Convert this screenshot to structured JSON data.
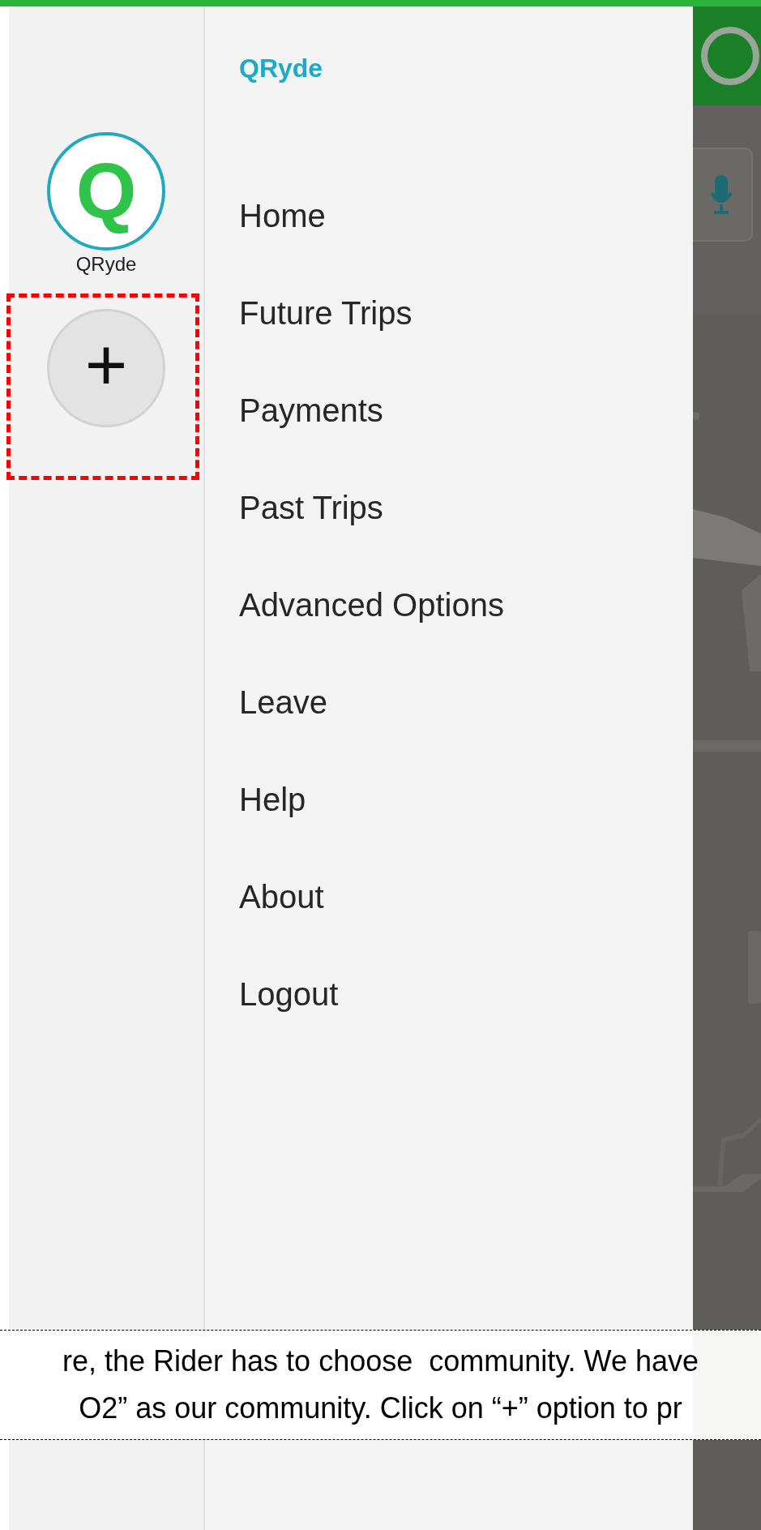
{
  "rail": {
    "communities": [
      {
        "letter": "Q",
        "name": "QRyde",
        "selected": false
      }
    ],
    "add_button": {
      "symbol": "+",
      "highlighted": true
    }
  },
  "drawer": {
    "title": "QRyde",
    "items": [
      {
        "label": "Home"
      },
      {
        "label": "Future Trips"
      },
      {
        "label": "Payments"
      },
      {
        "label": "Past Trips"
      },
      {
        "label": "Advanced Options"
      },
      {
        "label": "Leave"
      },
      {
        "label": "Help"
      },
      {
        "label": "About"
      },
      {
        "label": "Logout"
      }
    ]
  },
  "caption": {
    "lines": [
      "re, the Rider has to choose  community. We have",
      "O2” as our community. Click on “+” option to pr"
    ]
  }
}
